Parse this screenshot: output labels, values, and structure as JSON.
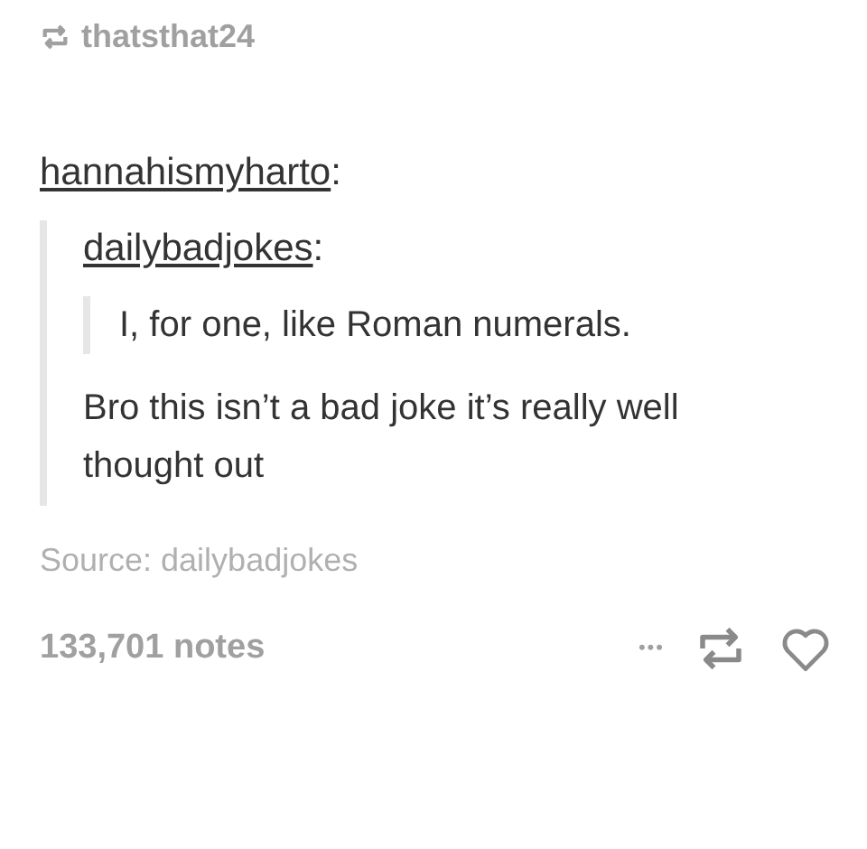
{
  "reblogger": "thatsthat24",
  "quote": {
    "author": "hannahismyharto",
    "colon": ":",
    "inner": {
      "author": "dailybadjokes",
      "colon": ":",
      "text": "I, for one, like Roman numerals."
    },
    "reply": "Bro this isn’t a bad joke it’s really well thought out"
  },
  "source": "Source: dailybadjokes",
  "notes": "133,701 notes",
  "more": "•••",
  "liked": false
}
